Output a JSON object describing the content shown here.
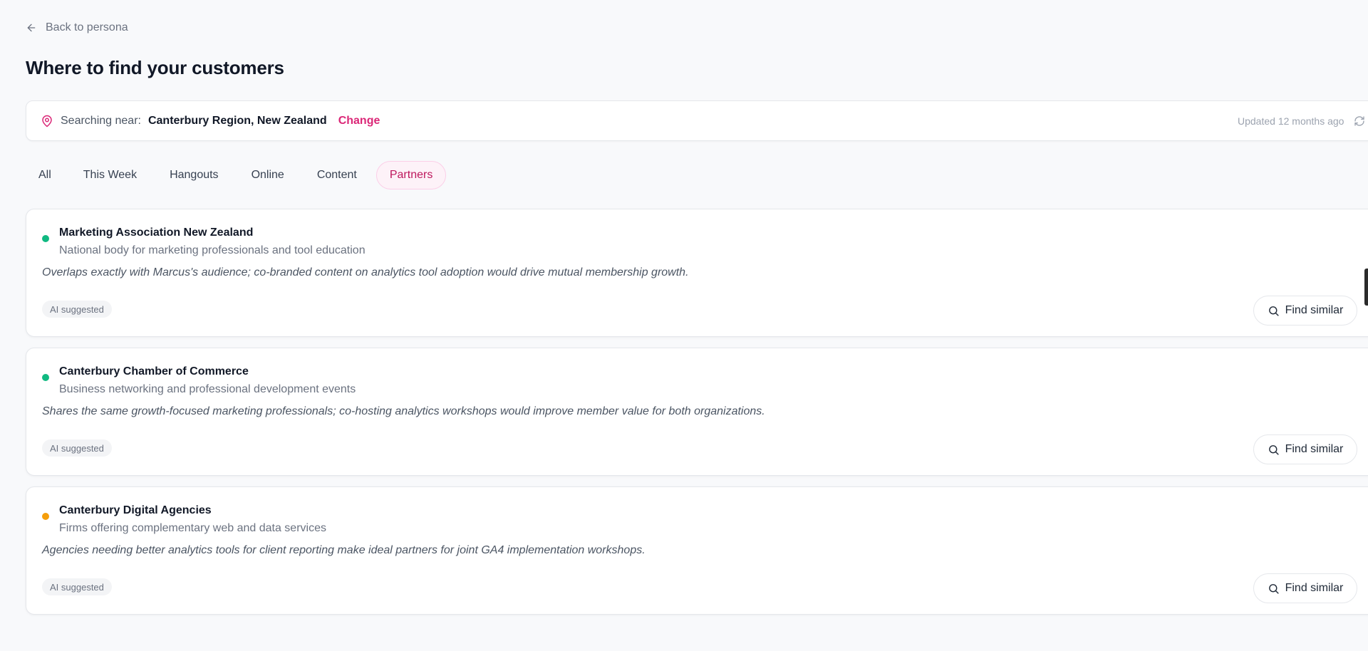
{
  "nav": {
    "back_label": "Back to persona"
  },
  "page": {
    "title": "Where to find your customers"
  },
  "location": {
    "label": "Searching near:",
    "value": "Canterbury Region, New Zealand",
    "change_label": "Change",
    "updated": "Updated 12 months ago"
  },
  "tabs": [
    {
      "label": "All"
    },
    {
      "label": "This Week"
    },
    {
      "label": "Hangouts"
    },
    {
      "label": "Online"
    },
    {
      "label": "Content"
    },
    {
      "label": "Partners",
      "active": true
    }
  ],
  "cards": [
    {
      "name": "Marketing Association New Zealand",
      "subtitle": "National body for marketing professionals and tool education",
      "description": "Overlaps exactly with Marcus's audience; co-branded content on analytics tool adoption would drive mutual membership growth.",
      "badge": "AI suggested",
      "button": "Find similar",
      "dot_color": "#10b981"
    },
    {
      "name": "Canterbury Chamber of Commerce",
      "subtitle": "Business networking and professional development events",
      "description": "Shares the same growth-focused marketing professionals; co-hosting analytics workshops would improve member value for both organizations.",
      "badge": "AI suggested",
      "button": "Find similar",
      "dot_color": "#10b981"
    },
    {
      "name": "Canterbury Digital Agencies",
      "subtitle": "Firms offering complementary web and data services",
      "description": "Agencies needing better analytics tools for client reporting make ideal partners for joint GA4 implementation workshops.",
      "badge": "AI suggested",
      "button": "Find similar",
      "dot_color": "#f59e0b"
    }
  ],
  "colors": {
    "accent": "#db2777",
    "accent_bg": "#fdf2f8"
  }
}
